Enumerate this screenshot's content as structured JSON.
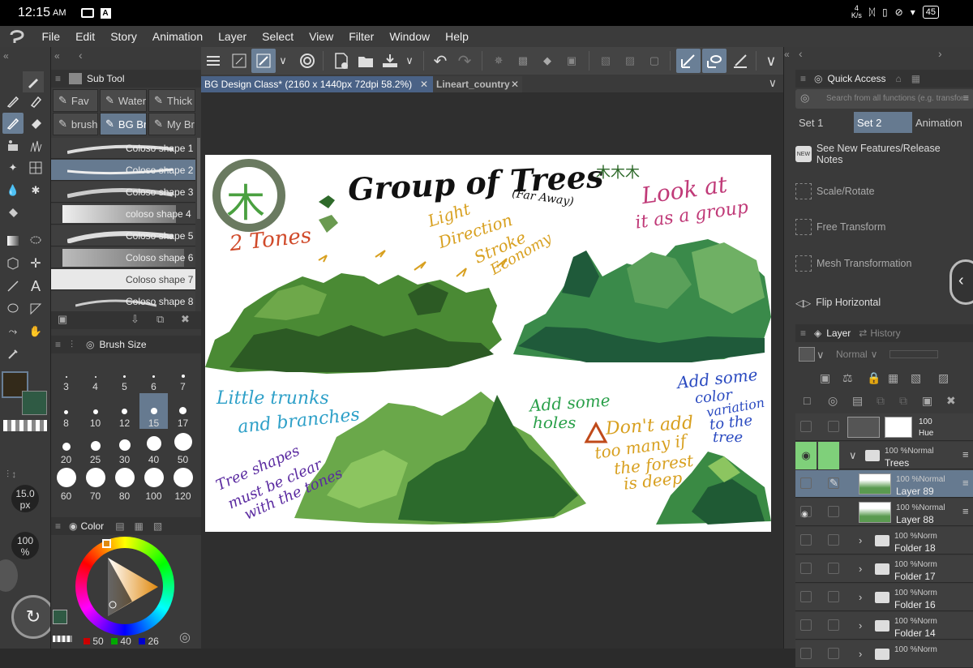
{
  "status_bar": {
    "time": "12:15",
    "ampm": "AM",
    "net_speed": "4\nK/s",
    "battery": "45"
  },
  "menu": [
    "File",
    "Edit",
    "Story",
    "Animation",
    "Layer",
    "Select",
    "View",
    "Filter",
    "Window",
    "Help"
  ],
  "subtool": {
    "header": "Sub Tool",
    "groups_row1": [
      "Fav",
      "Water",
      "Thick"
    ],
    "groups_row2": [
      "brush",
      "BG Br",
      "My Br"
    ],
    "brushes": [
      "Coloso shape 1",
      "Coloso shape 2",
      "Coloso shape 3",
      "coloso shape 4",
      "Coloso shape 5",
      "Coloso shape 6",
      "Coloso shape 7",
      "Coloso shape 8"
    ],
    "selected_brush": "Coloso shape 2"
  },
  "brush_size": {
    "header": "Brush Size",
    "values": [
      "3",
      "4",
      "5",
      "6",
      "7",
      "8",
      "10",
      "12",
      "15",
      "17",
      "20",
      "25",
      "30",
      "40",
      "50",
      "60",
      "70",
      "80",
      "100",
      "120"
    ],
    "selected": "15"
  },
  "tool_status": {
    "size": "15.0",
    "size_unit": "px",
    "opacity": "100",
    "opacity_unit": "%"
  },
  "color_panel": {
    "header": "Color",
    "r": "50",
    "g": "40",
    "b": "26"
  },
  "doc_tabs": [
    {
      "label": "BG Design Class* (2160 x 1440px 72dpi 58.2%)",
      "active": true
    },
    {
      "label": "Lineart_country",
      "active": false
    }
  ],
  "artwork": {
    "title": "Group of Trees",
    "subtitle": "(Far Away)",
    "note_look": "Look at",
    "note_look2": "it as a group",
    "note_tones": "2 Tones",
    "note_light": "Light",
    "note_direction": "Direction",
    "note_stroke": "Stroke",
    "note_economy": "Economy",
    "note_trunks": "Little trunks",
    "note_branches": "and branches",
    "note_shapes1": "Tree shapes",
    "note_shapes2": "must be clear",
    "note_shapes3": "with the tones",
    "note_holes1": "Add some",
    "note_holes2": "holes",
    "note_dont1": "Don't add",
    "note_dont2": "too many if",
    "note_dont3": "the forest",
    "note_dont4": "is deep",
    "note_var1": "Add some",
    "note_var2": "color",
    "note_var3": "variation",
    "note_var4": "to the",
    "note_var5": "tree",
    "badge_char": "木",
    "trees_glyph": "木木木",
    "colors": {
      "dark_green": "#2e6a2a",
      "mid_green": "#5a9a3e",
      "light_green": "#8cc560",
      "teal": "#2c7a4a"
    }
  },
  "quick_access": {
    "header": "Quick Access",
    "search_placeholder": "Search from all functions (e.g. transform)",
    "sets": [
      "Set 1",
      "Set 2",
      "Animation"
    ],
    "selected_set": "Set 2",
    "items": [
      "See New Features/Release Notes",
      "Scale/Rotate",
      "Free Transform",
      "Mesh Transformation",
      "Flip Horizontal"
    ]
  },
  "layer_panel": {
    "tab_layer": "Layer",
    "tab_history": "History",
    "blend_mode": "Normal",
    "layers": [
      {
        "opacity": "100",
        "mode": "Hue",
        "name": "",
        "type": "correction"
      },
      {
        "opacity": "100 %",
        "mode": "Normal",
        "name": "Trees",
        "type": "folder-open"
      },
      {
        "opacity": "100 %",
        "mode": "Normal",
        "name": "Layer 89",
        "type": "raster"
      },
      {
        "opacity": "100 %",
        "mode": "Normal",
        "name": "Layer 88",
        "type": "raster"
      },
      {
        "opacity": "100 %",
        "mode": "Norm",
        "name": "Folder 18",
        "type": "folder"
      },
      {
        "opacity": "100 %",
        "mode": "Norm",
        "name": "Folder 17",
        "type": "folder"
      },
      {
        "opacity": "100 %",
        "mode": "Norm",
        "name": "Folder 16",
        "type": "folder"
      },
      {
        "opacity": "100 %",
        "mode": "Norm",
        "name": "Folder 14",
        "type": "folder"
      },
      {
        "opacity": "100 %",
        "mode": "Norm",
        "name": "",
        "type": "folder"
      }
    ]
  }
}
